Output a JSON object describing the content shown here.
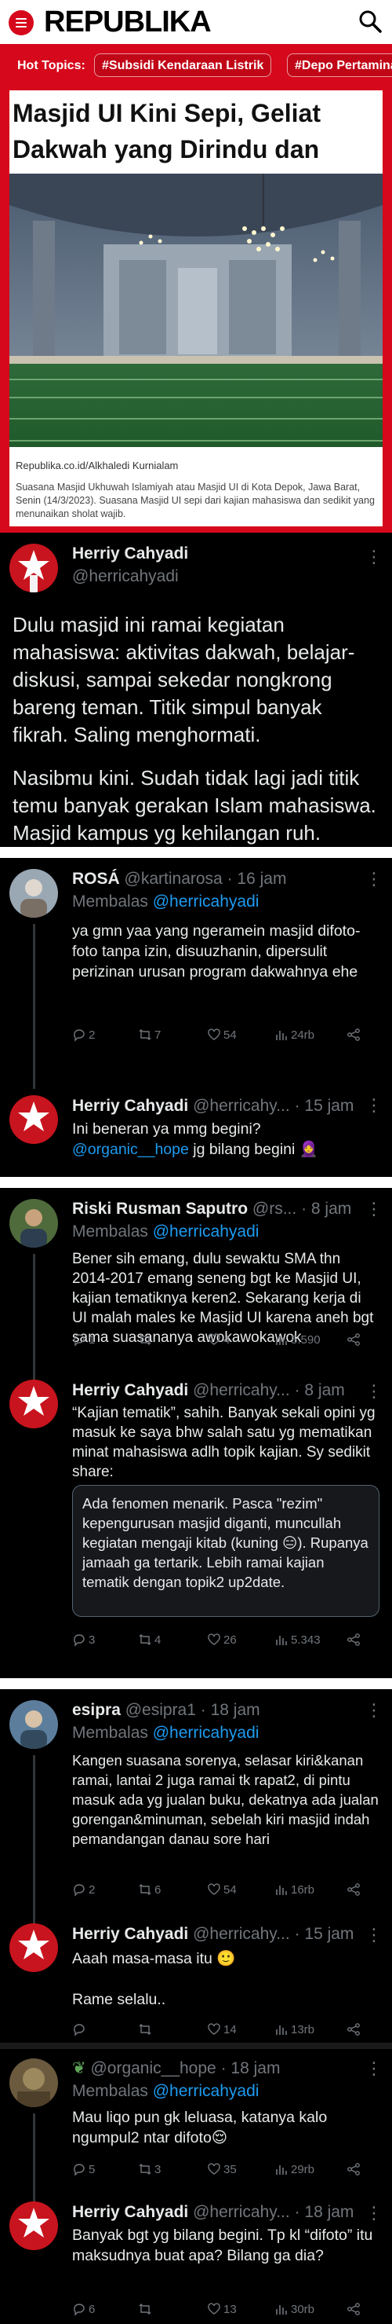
{
  "article": {
    "logo": "REPUBLIKA",
    "hot_label": "Hot Topics:",
    "chips": [
      "#Subsidi Kendaraan Listrik",
      "#Depo Pertamina Plumpang"
    ],
    "title": "Masjid UI Kini Sepi, Geliat Dakwah yang Dirindu dan",
    "credit": "Republika.co.id/Alkhaledi Kurnialam",
    "caption": "Suasana Masjid Ukhuwah Islamiyah atau Masjid UI di Kota Depok, Jawa Barat, Senin (14/3/2023). Suasana Masjid UI sepi dari kajian mahasiswa dan sedikit yang menunaikan sholat wajib."
  },
  "main_tweet": {
    "name": "Herriy Cahyadi",
    "handle": "@herricahyadi",
    "para1": "Dulu masjid ini ramai kegiatan mahasiswa: aktivitas dakwah, belajar-diskusi, sampai sekedar nongkrong bareng teman. Titik simpul banyak fikrah. Saling menghormati.",
    "para2": "Nasibmu kini. Sudah tidak lagi jadi titik temu banyak gerakan Islam mahasiswa. Masjid kampus yg kehilangan ruh."
  },
  "replies": [
    {
      "name": "ROSÁ",
      "handle": "@kartinarosa",
      "time": "· 16 jam",
      "reply_to": "@herricahyadi",
      "replying_label": "Membalas",
      "text": "ya gmn yaa yang ngeramein masjid difoto-foto tanpa izin, disuuzhanin, dipersulit perizinan urusan program dakwahnya ehe",
      "stats": {
        "reply": "2",
        "retweet": "7",
        "like": "54",
        "views": "24rb"
      }
    },
    {
      "name": "Herriy Cahyadi",
      "handle": "@herricahy...",
      "time": "· 15 jam",
      "text_a": "Ini beneran ya mmg begini?",
      "mention": "@organic__hope",
      "text_b": " jg bilang begini",
      "emoji": "🧕",
      "stats": {
        "reply": "",
        "retweet": "",
        "like": "",
        "views": ""
      }
    },
    {
      "name": "Riski Rusman Saputro",
      "handle": "@rs...",
      "time": "· 8 jam",
      "reply_to": "@herricahyadi",
      "replying_label": "Membalas",
      "text": "Bener sih emang, dulu sewaktu SMA thn 2014-2017 emang seneng bgt ke Masjid UI, kajian tematiknya keren2. Sekarang kerja di UI malah males ke Masjid UI karena aneh bgt sama suasananya awokawokawok",
      "stats": {
        "reply": "1",
        "retweet": "",
        "like": "4",
        "views": "5.590"
      }
    },
    {
      "name": "Herriy Cahyadi",
      "handle": "@herricahy...",
      "time": "· 8 jam",
      "text": "“Kajian tematik”, sahih. Banyak sekali opini yg masuk ke saya bhw salah satu yg mematikan minat mahasiswa adlh topik kajian. Sy sedikit share:",
      "quote": "Ada fenomen menarik. Pasca \"rezim\" kepengurusan masjid diganti, muncullah kegiatan mengaji kitab (kuning 😑). Rupanya jamaah ga tertarik. Lebih ramai kajian tematik dengan topik2 up2date.",
      "stats": {
        "reply": "3",
        "retweet": "4",
        "like": "26",
        "views": "5.343"
      }
    },
    {
      "name": "esipra",
      "handle": "@esipra1",
      "time": "· 18 jam",
      "reply_to": "@herricahyadi",
      "replying_label": "Membalas",
      "text": "Kangen suasana sorenya, selasar kiri&kanan ramai, lantai 2 juga ramai tk rapat2, di pintu masuk ada yg jualan buku, dekatnya ada jualan gorengan&minuman, sebelah kiri masjid indah pemandangan danau sore hari",
      "stats": {
        "reply": "2",
        "retweet": "6",
        "like": "54",
        "views": "16rb"
      }
    },
    {
      "name": "Herriy Cahyadi",
      "handle": "@herricahy...",
      "time": "· 15 jam",
      "text_a": "Aaah masa-masa itu 🙂",
      "text_b": "Rame selalu..",
      "stats": {
        "reply": "",
        "retweet": "",
        "like": "14",
        "views": "13rb"
      }
    },
    {
      "name": "@organic__hope",
      "handle": "",
      "time": "· 18 jam",
      "reply_to": "@herricahyadi",
      "replying_label": "Membalas",
      "text": "Mau liqo pun gk leluasa, katanya kalo ngumpul2 ntar difoto😌",
      "stats": {
        "reply": "5",
        "retweet": "3",
        "like": "35",
        "views": "29rb"
      }
    },
    {
      "name": "Herriy Cahyadi",
      "handle": "@herricahy...",
      "time": "· 18 jam",
      "text": "Banyak bgt yg bilang begini. Tp kl “difoto” itu maksudnya buat apa? Bilang ga dia?",
      "stats": {
        "reply": "6",
        "retweet": "",
        "like": "13",
        "views": "30rb"
      }
    }
  ],
  "colors": {
    "brand_red": "#d6081b",
    "link_blue": "#1d9bf0",
    "muted": "#71767b",
    "text": "#e7e9ea"
  }
}
